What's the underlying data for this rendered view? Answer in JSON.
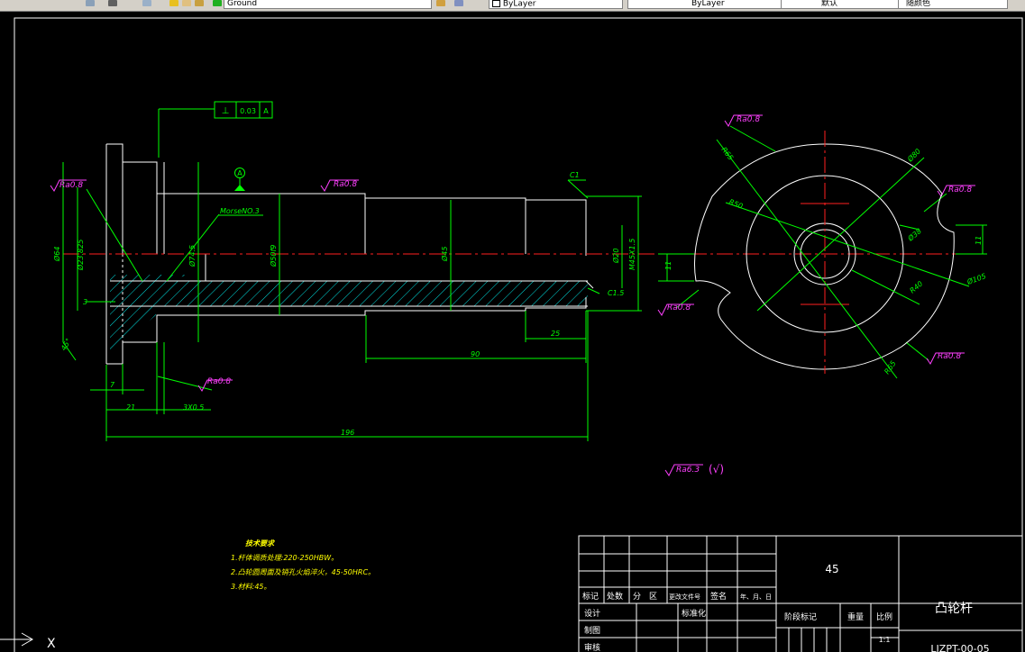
{
  "toolbar": {
    "layer_value": "Ground",
    "color_value": "ByLayer",
    "linetype_value": "ByLayer",
    "lineweight_value": "默认",
    "plotstyle_value": "随颜色"
  },
  "drawing": {
    "surface_finish": {
      "ra08": "Ra0.8",
      "ra63": "Ra6.3",
      "general_suffix": "(√)"
    },
    "datum_label": "A",
    "geometric_tolerance": {
      "symbol": "⊥",
      "value": "0.03",
      "datum": "A"
    },
    "chamfers": {
      "c1": "C1",
      "c15": "C1.5"
    },
    "morse_taper": "MorseNO.3",
    "dimensions": {
      "d64": "Ø64",
      "d23825": "Ø23.825",
      "d745": "Ø74.5",
      "d50f9": "Ø50f9",
      "d45": "Ø45",
      "d20": "Ø20",
      "thread": "M45X1.5",
      "len3": "3",
      "ang45": "45°",
      "len7": "7",
      "len21": "21",
      "groove": "3X0.5",
      "len25": "25",
      "len90": "90",
      "len196": "196",
      "r65a": "R65",
      "r50": "R50",
      "r40": "R40",
      "r65b": "R65",
      "d80": "Ø80",
      "d38": "Ø38",
      "d105": "Ø105",
      "w11a": "11",
      "w11b": "11"
    },
    "tech_requirements": {
      "title": "技术要求",
      "items": [
        "1.杆体调质处理:220-250HBW。",
        "2.凸轮圆周面及销孔火焰淬火，45-50HRC。",
        "3.材料:45。"
      ]
    }
  },
  "title_block": {
    "material": "45",
    "part_name": "凸轮杆",
    "drawing_number": "LJZPT-00-05",
    "scale": "1:1",
    "labels": {
      "mark": "标记",
      "count": "处数",
      "zone": "分",
      "area": "区",
      "change_doc": "更改文件号",
      "sign": "签名",
      "date": "年、月、日",
      "design": "设计",
      "standardize": "标准化",
      "draw": "制图",
      "review": "审核",
      "stage": "阶段标记",
      "weight": "重量",
      "ratio": "比例"
    }
  },
  "ucs": {
    "axis_x": "X"
  }
}
